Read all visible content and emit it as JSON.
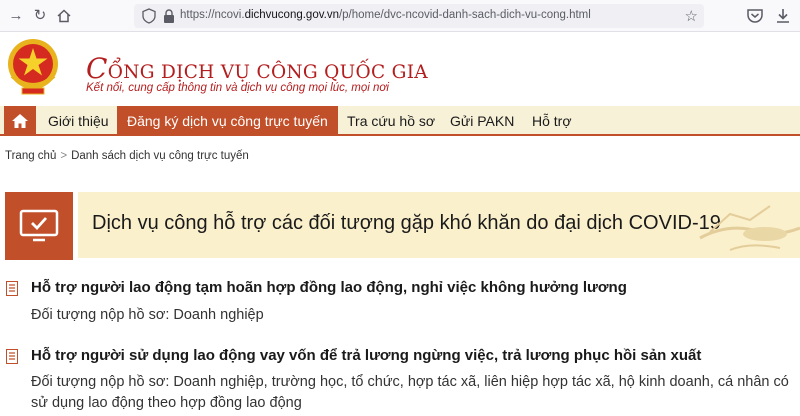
{
  "browser": {
    "url_prefix": "https://ncovi.",
    "url_domain": "dichvucong.gov.vn",
    "url_path": "/p/home/dvc-ncovid-danh-sach-dich-vu-cong.html"
  },
  "header": {
    "title_initial": "C",
    "title_rest": "ỔNG DỊCH VỤ CÔNG QUỐC GIA",
    "tagline": "Kết nối, cung cấp thông tin và dịch vụ công mọi lúc, mọi nơi"
  },
  "menu": {
    "items": [
      "Giới thiệu",
      "Đăng ký dịch vụ công trực tuyến",
      "Tra cứu hồ sơ",
      "Gửi PAKN",
      "Hỗ trợ"
    ]
  },
  "breadcrumb": {
    "home": "Trang chủ",
    "current": "Danh sách dịch vụ công trực tuyến"
  },
  "banner": {
    "title": "Dịch vụ công hỗ trợ các đối tượng gặp khó khăn do đại dịch COVID-19"
  },
  "services": [
    {
      "title": "Hỗ trợ người lao động tạm hoãn hợp đồng lao động, nghỉ việc không hưởng lương",
      "subjects_line1": "Đối tượng nộp hồ sơ: Doanh nghiệp",
      "subjects_line2": ""
    },
    {
      "title": "Hỗ trợ người sử dụng lao động vay vốn để trả lương ngừng việc, trả lương phục hồi sản xuất",
      "subjects_line1": "Đối tượng nộp hồ sơ: Doanh nghiệp, trường học, tổ chức, hợp tác xã, liên hiệp hợp tác xã, hộ kinh doanh, cá nhân có",
      "subjects_line2": "sử dụng lao động theo hợp đồng lao động"
    }
  ],
  "colors": {
    "brand_red": "#b41e1e",
    "accent_orange": "#c1502a",
    "menu_bg": "#f7f1d8",
    "banner_bg": "#fbf0cc"
  }
}
